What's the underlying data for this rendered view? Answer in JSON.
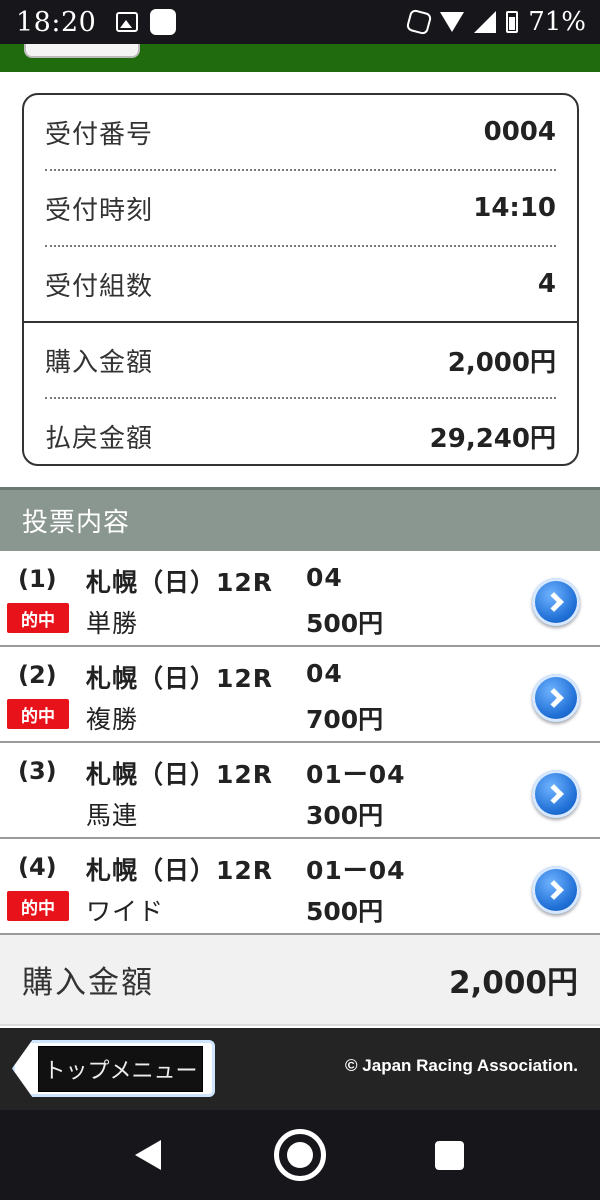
{
  "status_bar": {
    "time": "18:20",
    "battery": "71%",
    "icons": [
      "image-icon",
      "app-square-icon",
      "nfc-icon",
      "wifi-icon",
      "signal-icon",
      "battery-icon"
    ]
  },
  "receipt": {
    "rows": [
      {
        "label": "受付番号",
        "value": "0004"
      },
      {
        "label": "受付時刻",
        "value": "14:10"
      },
      {
        "label": "受付組数",
        "value": "4"
      },
      {
        "label": "購入金額",
        "value": "2,000円"
      },
      {
        "label": "払戻金額",
        "value": "29,240円"
      }
    ]
  },
  "section": {
    "title": "投票内容"
  },
  "bets": [
    {
      "num": "(1)",
      "race": "札幌（日）12R",
      "combo": "04",
      "type": "単勝",
      "amount": "500円",
      "hit": "的中"
    },
    {
      "num": "(2)",
      "race": "札幌（日）12R",
      "combo": "04",
      "type": "複勝",
      "amount": "700円",
      "hit": "的中"
    },
    {
      "num": "(3)",
      "race": "札幌（日）12R",
      "combo": "01ー04",
      "type": "馬連",
      "amount": "300円",
      "hit": ""
    },
    {
      "num": "(4)",
      "race": "札幌（日）12R",
      "combo": "01ー04",
      "type": "ワイド",
      "amount": "500円",
      "hit": "的中"
    }
  ],
  "total": {
    "label": "購入金額",
    "value": "2,000円"
  },
  "footer": {
    "top_menu_label": "トップメニュー",
    "copyright": "© Japan Racing Association."
  },
  "colors": {
    "header_green": "#1f6b0e",
    "hit_red": "#e8121b",
    "section_gray": "#8a9690",
    "button_blue": "#1f6fd6"
  }
}
